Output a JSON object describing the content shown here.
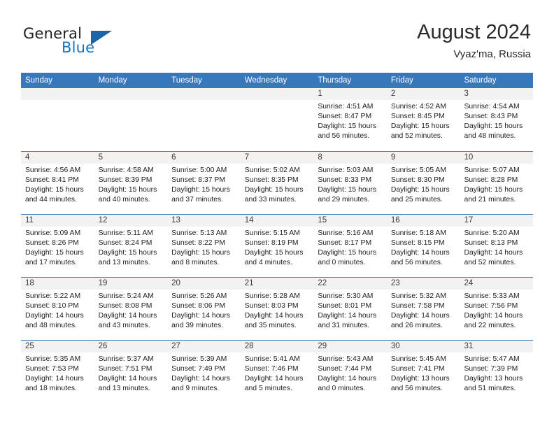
{
  "brand": {
    "name_top": "General",
    "name_bottom": "Blue",
    "logo_icon": "triangle-icon"
  },
  "header": {
    "title": "August 2024",
    "subtitle": "Vyaz'ma, Russia"
  },
  "calendar": {
    "weekday_headers": [
      "Sunday",
      "Monday",
      "Tuesday",
      "Wednesday",
      "Thursday",
      "Friday",
      "Saturday"
    ],
    "labels": {
      "sunrise": "Sunrise:",
      "sunset": "Sunset:",
      "daylight": "Daylight:"
    },
    "colors": {
      "header_blue": "#3778bd",
      "brand_blue": "#1275c4",
      "day_band_gray": "#f2f2f2",
      "text": "#1d1d1d"
    },
    "weeks": [
      [
        {
          "day": "",
          "empty": true
        },
        {
          "day": "",
          "empty": true
        },
        {
          "day": "",
          "empty": true
        },
        {
          "day": "",
          "empty": true
        },
        {
          "day": "1",
          "sunrise": "Sunrise: 4:51 AM",
          "sunset": "Sunset: 8:47 PM",
          "daylight": "Daylight: 15 hours and 56 minutes."
        },
        {
          "day": "2",
          "sunrise": "Sunrise: 4:52 AM",
          "sunset": "Sunset: 8:45 PM",
          "daylight": "Daylight: 15 hours and 52 minutes."
        },
        {
          "day": "3",
          "sunrise": "Sunrise: 4:54 AM",
          "sunset": "Sunset: 8:43 PM",
          "daylight": "Daylight: 15 hours and 48 minutes."
        }
      ],
      [
        {
          "day": "4",
          "sunrise": "Sunrise: 4:56 AM",
          "sunset": "Sunset: 8:41 PM",
          "daylight": "Daylight: 15 hours and 44 minutes."
        },
        {
          "day": "5",
          "sunrise": "Sunrise: 4:58 AM",
          "sunset": "Sunset: 8:39 PM",
          "daylight": "Daylight: 15 hours and 40 minutes."
        },
        {
          "day": "6",
          "sunrise": "Sunrise: 5:00 AM",
          "sunset": "Sunset: 8:37 PM",
          "daylight": "Daylight: 15 hours and 37 minutes."
        },
        {
          "day": "7",
          "sunrise": "Sunrise: 5:02 AM",
          "sunset": "Sunset: 8:35 PM",
          "daylight": "Daylight: 15 hours and 33 minutes."
        },
        {
          "day": "8",
          "sunrise": "Sunrise: 5:03 AM",
          "sunset": "Sunset: 8:33 PM",
          "daylight": "Daylight: 15 hours and 29 minutes."
        },
        {
          "day": "9",
          "sunrise": "Sunrise: 5:05 AM",
          "sunset": "Sunset: 8:30 PM",
          "daylight": "Daylight: 15 hours and 25 minutes."
        },
        {
          "day": "10",
          "sunrise": "Sunrise: 5:07 AM",
          "sunset": "Sunset: 8:28 PM",
          "daylight": "Daylight: 15 hours and 21 minutes."
        }
      ],
      [
        {
          "day": "11",
          "sunrise": "Sunrise: 5:09 AM",
          "sunset": "Sunset: 8:26 PM",
          "daylight": "Daylight: 15 hours and 17 minutes."
        },
        {
          "day": "12",
          "sunrise": "Sunrise: 5:11 AM",
          "sunset": "Sunset: 8:24 PM",
          "daylight": "Daylight: 15 hours and 13 minutes."
        },
        {
          "day": "13",
          "sunrise": "Sunrise: 5:13 AM",
          "sunset": "Sunset: 8:22 PM",
          "daylight": "Daylight: 15 hours and 8 minutes."
        },
        {
          "day": "14",
          "sunrise": "Sunrise: 5:15 AM",
          "sunset": "Sunset: 8:19 PM",
          "daylight": "Daylight: 15 hours and 4 minutes."
        },
        {
          "day": "15",
          "sunrise": "Sunrise: 5:16 AM",
          "sunset": "Sunset: 8:17 PM",
          "daylight": "Daylight: 15 hours and 0 minutes."
        },
        {
          "day": "16",
          "sunrise": "Sunrise: 5:18 AM",
          "sunset": "Sunset: 8:15 PM",
          "daylight": "Daylight: 14 hours and 56 minutes."
        },
        {
          "day": "17",
          "sunrise": "Sunrise: 5:20 AM",
          "sunset": "Sunset: 8:13 PM",
          "daylight": "Daylight: 14 hours and 52 minutes."
        }
      ],
      [
        {
          "day": "18",
          "sunrise": "Sunrise: 5:22 AM",
          "sunset": "Sunset: 8:10 PM",
          "daylight": "Daylight: 14 hours and 48 minutes."
        },
        {
          "day": "19",
          "sunrise": "Sunrise: 5:24 AM",
          "sunset": "Sunset: 8:08 PM",
          "daylight": "Daylight: 14 hours and 43 minutes."
        },
        {
          "day": "20",
          "sunrise": "Sunrise: 5:26 AM",
          "sunset": "Sunset: 8:06 PM",
          "daylight": "Daylight: 14 hours and 39 minutes."
        },
        {
          "day": "21",
          "sunrise": "Sunrise: 5:28 AM",
          "sunset": "Sunset: 8:03 PM",
          "daylight": "Daylight: 14 hours and 35 minutes."
        },
        {
          "day": "22",
          "sunrise": "Sunrise: 5:30 AM",
          "sunset": "Sunset: 8:01 PM",
          "daylight": "Daylight: 14 hours and 31 minutes."
        },
        {
          "day": "23",
          "sunrise": "Sunrise: 5:32 AM",
          "sunset": "Sunset: 7:58 PM",
          "daylight": "Daylight: 14 hours and 26 minutes."
        },
        {
          "day": "24",
          "sunrise": "Sunrise: 5:33 AM",
          "sunset": "Sunset: 7:56 PM",
          "daylight": "Daylight: 14 hours and 22 minutes."
        }
      ],
      [
        {
          "day": "25",
          "sunrise": "Sunrise: 5:35 AM",
          "sunset": "Sunset: 7:53 PM",
          "daylight": "Daylight: 14 hours and 18 minutes."
        },
        {
          "day": "26",
          "sunrise": "Sunrise: 5:37 AM",
          "sunset": "Sunset: 7:51 PM",
          "daylight": "Daylight: 14 hours and 13 minutes."
        },
        {
          "day": "27",
          "sunrise": "Sunrise: 5:39 AM",
          "sunset": "Sunset: 7:49 PM",
          "daylight": "Daylight: 14 hours and 9 minutes."
        },
        {
          "day": "28",
          "sunrise": "Sunrise: 5:41 AM",
          "sunset": "Sunset: 7:46 PM",
          "daylight": "Daylight: 14 hours and 5 minutes."
        },
        {
          "day": "29",
          "sunrise": "Sunrise: 5:43 AM",
          "sunset": "Sunset: 7:44 PM",
          "daylight": "Daylight: 14 hours and 0 minutes."
        },
        {
          "day": "30",
          "sunrise": "Sunrise: 5:45 AM",
          "sunset": "Sunset: 7:41 PM",
          "daylight": "Daylight: 13 hours and 56 minutes."
        },
        {
          "day": "31",
          "sunrise": "Sunrise: 5:47 AM",
          "sunset": "Sunset: 7:39 PM",
          "daylight": "Daylight: 13 hours and 51 minutes."
        }
      ]
    ]
  }
}
